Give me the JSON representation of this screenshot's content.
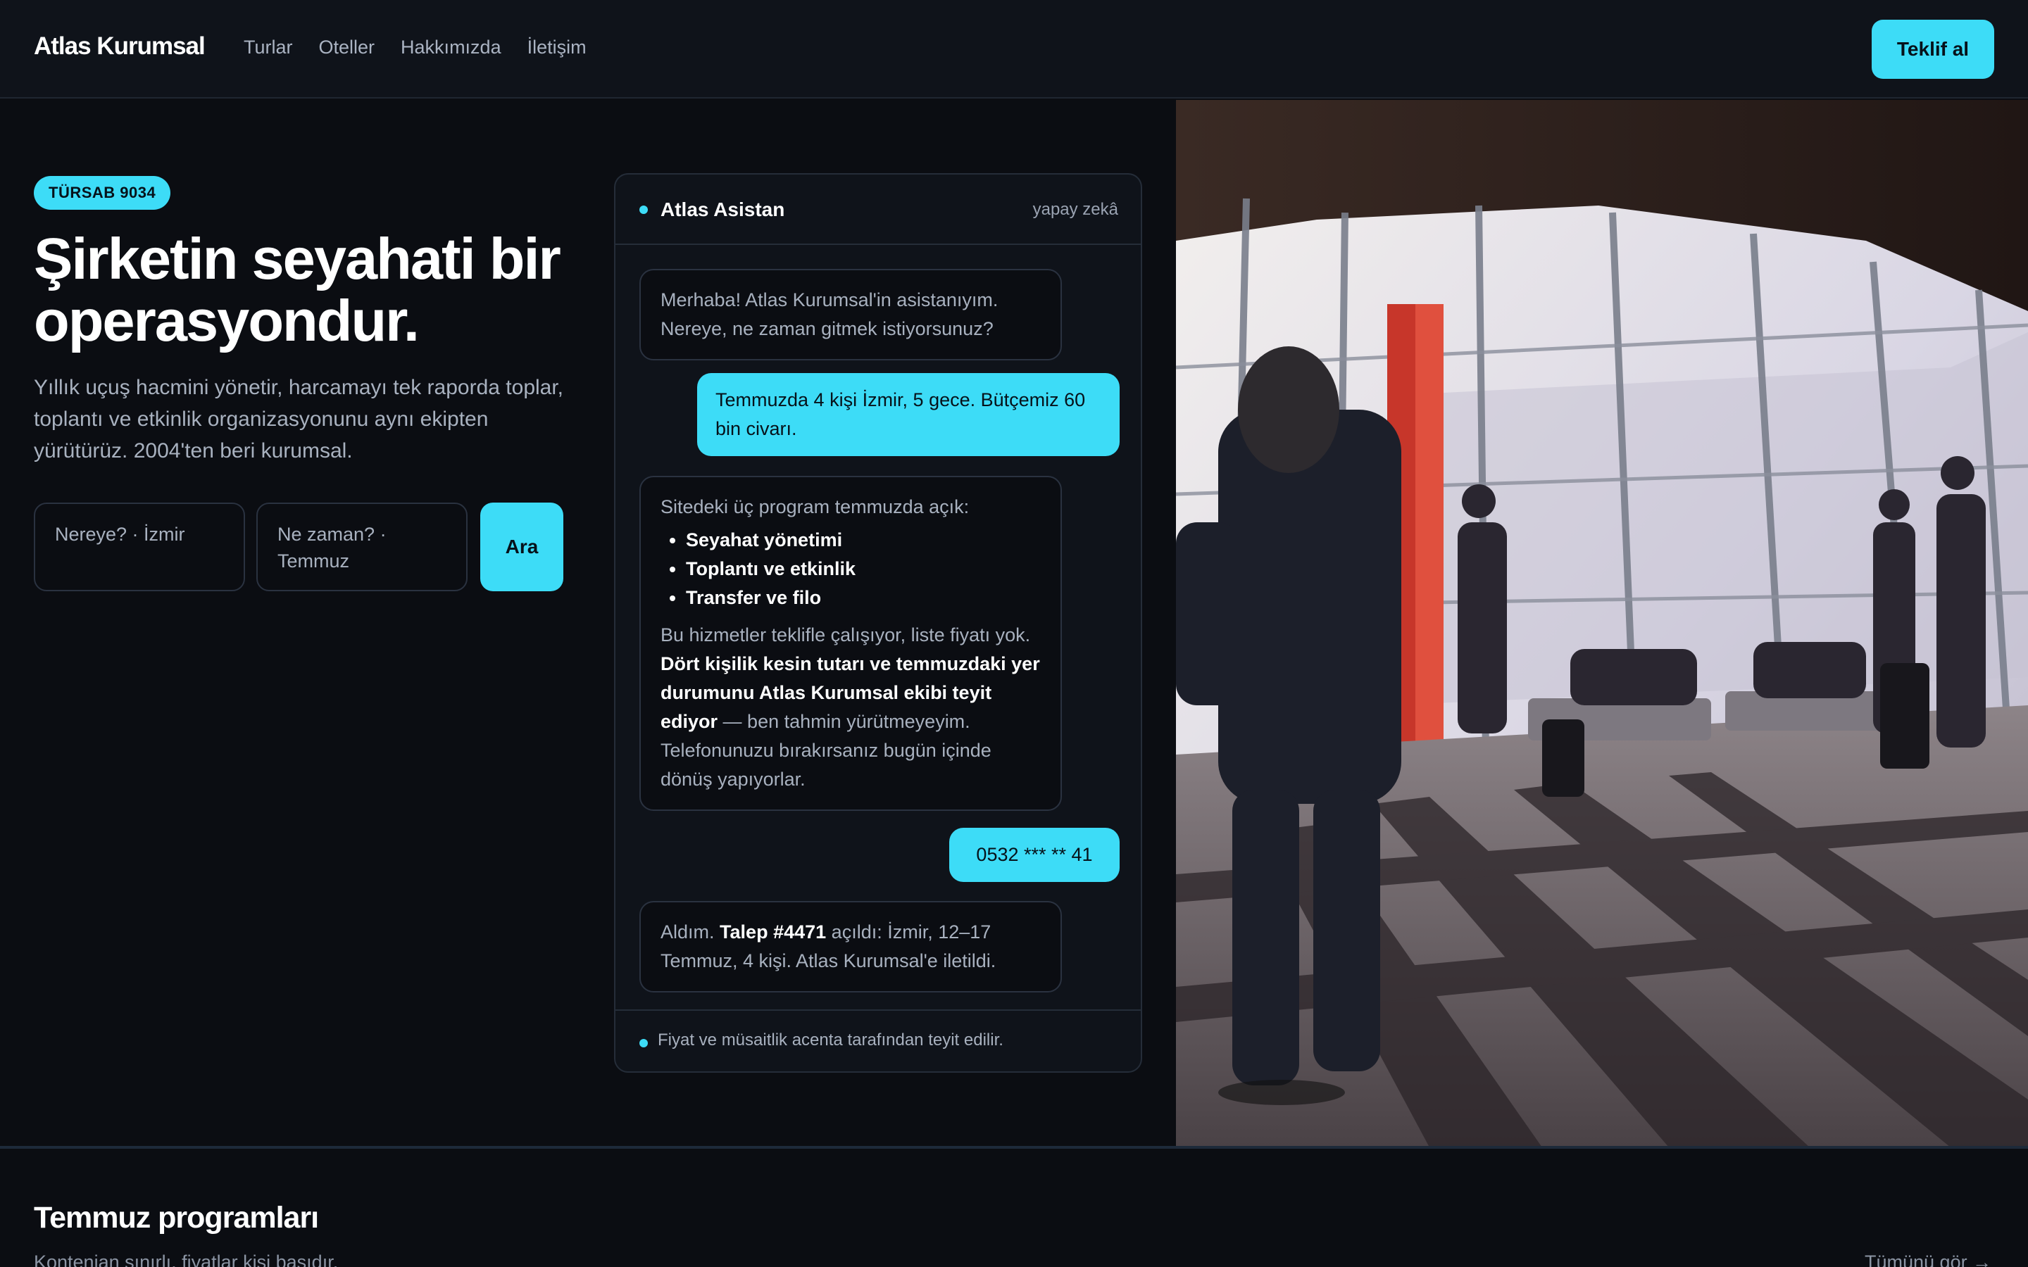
{
  "header": {
    "brand": "Atlas Kurumsal",
    "nav": [
      "Turlar",
      "Oteller",
      "Hakkımızda",
      "İletişim"
    ],
    "cta_label": "Teklif al"
  },
  "hero": {
    "badge": "TÜRSAB 9034",
    "title": "Şirketin seyahati bir operasyondur.",
    "subtitle": "Yıllık uçuş hacmini yönetir, harcamayı tek raporda toplar, toplantı ve etkinlik organizasyonunu aynı ekipten yürütürüz. 2004'ten beri kurumsal.",
    "search": {
      "where_label": "Nereye? · İzmir",
      "when_label": "Ne zaman? · Temmuz",
      "button_label": "Ara"
    }
  },
  "chat": {
    "title": "Atlas Asistan",
    "tag": "yapay zekâ",
    "msg1": "Merhaba! Atlas Kurumsal'in asistanıyım. Nereye, ne zaman gitmek istiyorsunuz?",
    "msg2": "Temmuzda 4 kişi İzmir, 5 gece. Bütçemiz 60 bin civarı.",
    "msg3": {
      "intro": "Sitedeki üç program temmuzda açık:",
      "programs": [
        "Seyahat yönetimi",
        "Toplantı ve etkinlik",
        "Transfer ve filo"
      ],
      "text_a": "Bu hizmetler teklifle çalışıyor, liste fiyatı yok.",
      "text_b": "Dört kişilik kesin tutarı ve temmuzdaki yer durumunu Atlas Kurumsal ekibi teyit ediyor",
      "text_c": "— ben tahmin yürütmeyeyim. Telefonunuzu bırakırsanız bugün içinde dönüş yapıyorlar."
    },
    "msg4": "0532 *** ** 41",
    "msg5": {
      "a": "Aldım.",
      "b": "Talep #4471",
      "c": "açıldı: İzmir, 12–17 Temmuz, 4 kişi. Atlas Kurumsal'e iletildi."
    },
    "footer": "Fiyat ve müsaitlik acenta tarafından teyit edilir."
  },
  "programs": {
    "title": "Temmuz programları",
    "subtitle": "Kontenjan sınırlı, fiyatlar kişi başıdır.",
    "see_all": "Tümünü gör →"
  },
  "colors": {
    "accent": "#3ddcf7",
    "background": "#0b0d12",
    "panel": "#0f131a"
  }
}
